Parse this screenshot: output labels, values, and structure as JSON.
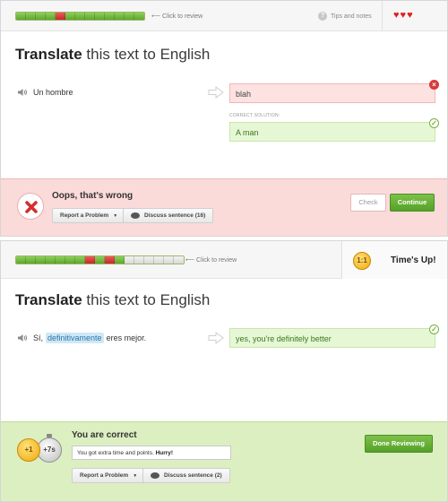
{
  "colors": {
    "correct_segment": "#6cb83a",
    "wrong_segment": "#d32f2f",
    "empty_segment": "#e0e0e0",
    "error_bg": "#fbdada",
    "success_bg": "#dcefc1",
    "primary_button": "#5ea82e",
    "heart": "#e02020",
    "highlight": "#cfe8f6"
  },
  "screen1": {
    "progress": [
      "c",
      "c",
      "c",
      "c",
      "w",
      "c",
      "c",
      "c",
      "c",
      "c",
      "c",
      "c",
      "c"
    ],
    "review_label": "Click to review",
    "tips_label": "Tips and notes",
    "hearts": [
      "heart-icon",
      "heart-icon",
      "heart-icon"
    ],
    "heading_bold": "Translate",
    "heading_rest": "this text to English",
    "prompt": "Un hombre",
    "user_answer": "blah",
    "correct_solution_label": "CORRECT SOLUTION:",
    "correct_solution": "A man",
    "status_title": "Oops, that's wrong",
    "report_label": "Report a Problem",
    "discuss_label": "Discuss sentence (16)",
    "check_label": "Check",
    "continue_label": "Continue"
  },
  "screen2": {
    "progress": [
      "c",
      "c",
      "c",
      "c",
      "c",
      "c",
      "c",
      "w",
      "c",
      "w",
      "c",
      "e",
      "e",
      "e",
      "e",
      "e",
      "e"
    ],
    "review_label": "Click to review",
    "timer_badge": "1:1",
    "times_up_label": "Time's Up!",
    "heading_bold": "Translate",
    "heading_rest": "this text to English",
    "prompt_before": "Sí,",
    "prompt_highlight": "definitivamente",
    "prompt_after": "eres mejor.",
    "user_answer": "yes, you're definitely better",
    "status_title": "You are correct",
    "coin_label": "+1",
    "time_bonus": "+7s",
    "feedback_text": "You got extra time and points.",
    "feedback_bold": "Hurry!",
    "report_label": "Report a Problem",
    "discuss_label": "Discuss sentence (2)",
    "done_label": "Done Reviewing"
  }
}
